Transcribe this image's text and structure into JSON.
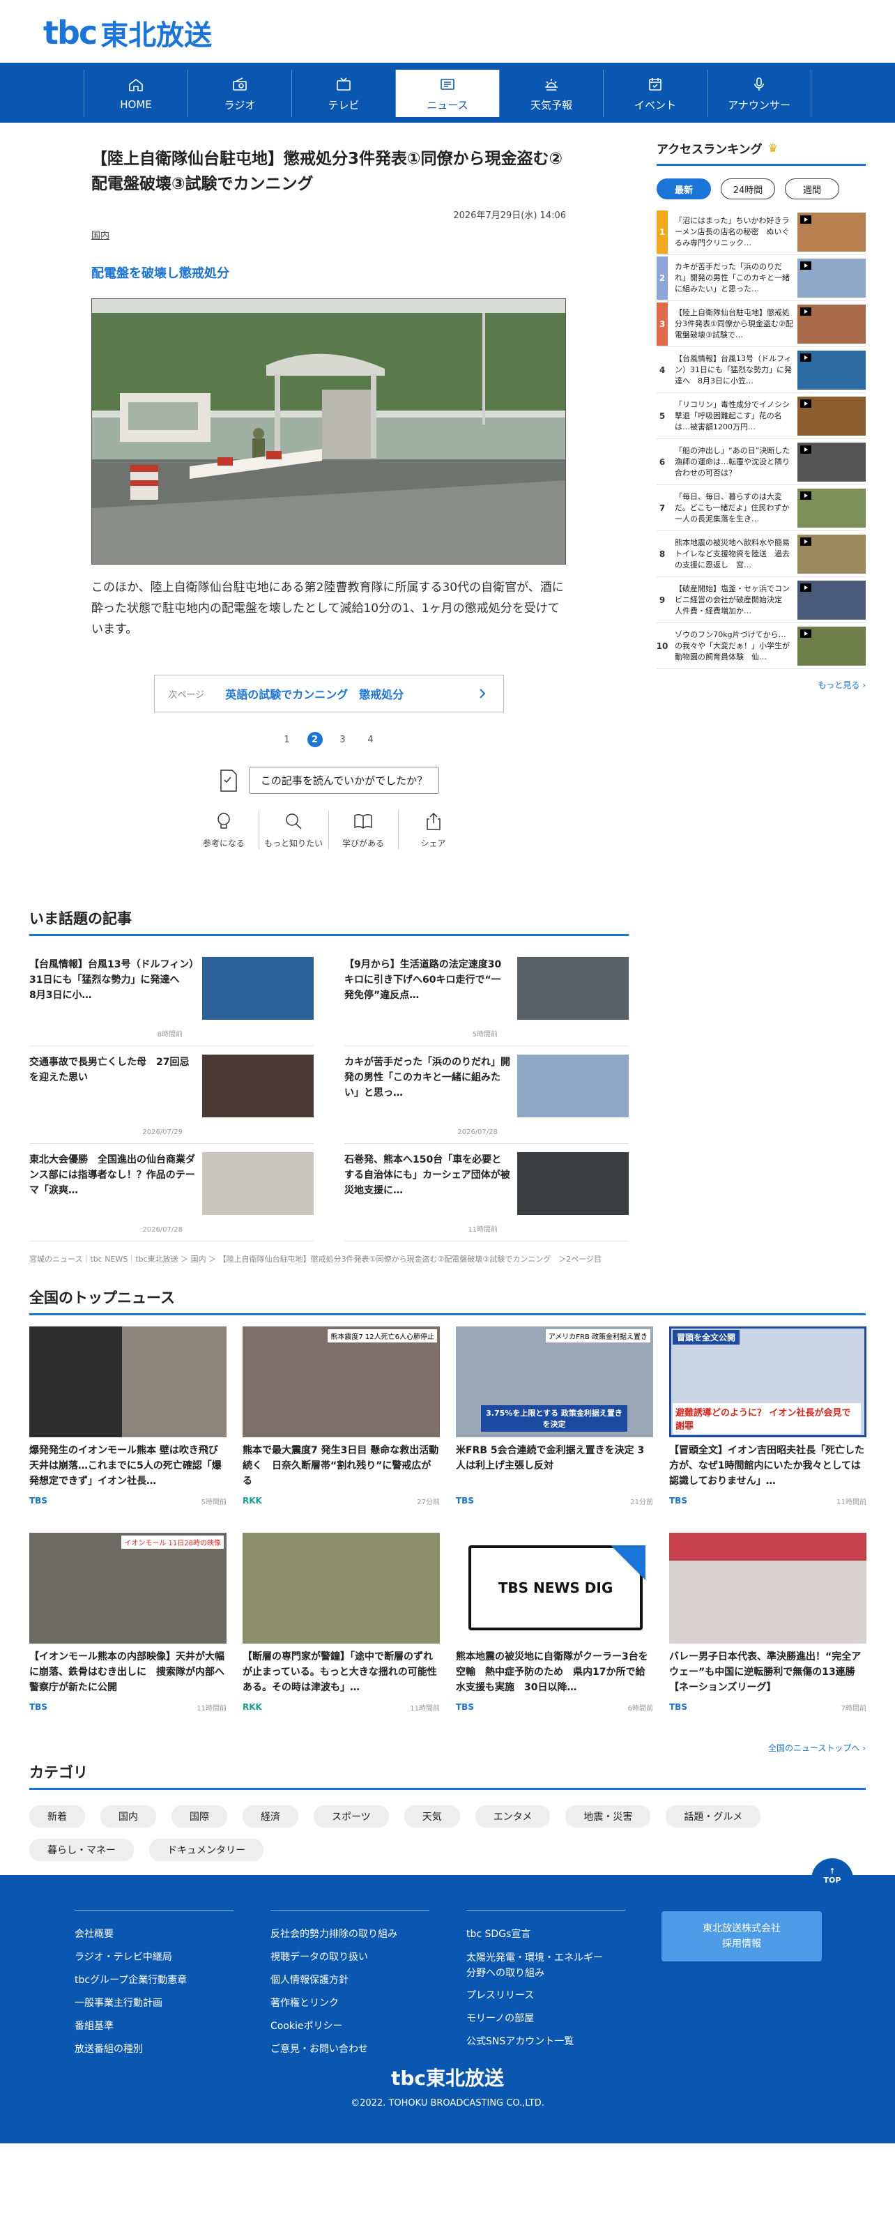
{
  "header": {
    "logo_mark": "tbc",
    "logo_name": "東北放送"
  },
  "nav": [
    {
      "label": "HOME",
      "icon": "home-icon"
    },
    {
      "label": "ラジオ",
      "icon": "radio-icon"
    },
    {
      "label": "テレビ",
      "icon": "tv-icon"
    },
    {
      "label": "ニュース",
      "icon": "news-icon",
      "active": true
    },
    {
      "label": "天気予報",
      "icon": "weather-icon"
    },
    {
      "label": "イベント",
      "icon": "event-icon"
    },
    {
      "label": "アナウンサー",
      "icon": "mic-icon"
    }
  ],
  "article": {
    "title": "【陸上自衛隊仙台駐屯地】懲戒処分3件発表①同僚から現金盗む②配電盤破壊③試験でカンニング",
    "date": "2026年7月29日(水) 14:06",
    "category": "国内",
    "subheading": "配電盤を破壊し懲戒処分",
    "body": "このほか、陸上自衛隊仙台駐屯地にある第2陸曹教育隊に所属する30代の自衛官が、酒に酔った状態で駐屯地内の配電盤を壊したとして減給10分の1、1ヶ月の懲戒処分を受けています。",
    "next_label": "次ページ",
    "next_title": "英語の試験でカンニング　懲戒処分",
    "pages": [
      "1",
      "2",
      "3",
      "4"
    ],
    "current_page": "2",
    "feedback_question": "この記事を読んでいかがでしたか？",
    "reactions": [
      "参考になる",
      "もっと知りたい",
      "学びがある",
      "シェア"
    ]
  },
  "ranking": {
    "title": "アクセスランキング",
    "tabs": [
      "最新",
      "24時間",
      "週間"
    ],
    "active_tab": "最新",
    "items": [
      {
        "rank": "1",
        "text": "「沼にはまった」ちいかわ好きラーメン店長の店名の秘密　ぬいぐるみ専門クリニック…"
      },
      {
        "rank": "2",
        "text": "カキが苦手だった「浜ののりだれ」開発の男性「このカキと一緒に組みたい」と思った…"
      },
      {
        "rank": "3",
        "text": "【陸上自衛隊仙台駐屯地】懲戒処分3件発表①同僚から現金盗む②配電盤破壊③試験で…"
      },
      {
        "rank": "4",
        "text": "【台風情報】台風13号（ドルフィン）31日にも「猛烈な勢力」に発達へ　8月3日に小笠…"
      },
      {
        "rank": "5",
        "text": "「リコリン」毒性成分でイノシシ撃退「呼吸困難起こす」花の名は…被害額1200万円…"
      },
      {
        "rank": "6",
        "text": "「船の沖出し」“あの日”決断した漁師の運命は…転覆や沈没と隣り合わせの可否は？"
      },
      {
        "rank": "7",
        "text": "「毎日、毎日、暮らすのは大変だ。どこも一緒だよ」住民わずか一人の長泥集落を生き…"
      },
      {
        "rank": "8",
        "text": "熊本地震の被災地へ飲料水や簡易トイレなど支援物資を陸送　過去の支援に恩返し　宮…"
      },
      {
        "rank": "9",
        "text": "【破産開始】塩釜・セヶ浜でコンビニ経営の会社が破産開始決定　人件費・経費増加か…"
      },
      {
        "rank": "10",
        "text": "ゾウのフン70kg片づけてから…の我々や「大変だぁ！」小学生が動物園の飼育員体験　仙…"
      }
    ],
    "more": "もっと見る ›"
  },
  "trending": {
    "title": "いま話題の記事",
    "items": [
      {
        "text": "【台風情報】台風13号（ドルフィン）31日にも「猛烈な勢力」に発達へ　8月3日に小…",
        "date": "8時間前"
      },
      {
        "text": "【9月から】生活道路の法定速度30キロに引き下げへ60キロ走行で“一発免停”違反点…",
        "date": "5時間前"
      },
      {
        "text": "交通事故で長男亡くした母　27回忌を迎えた思い",
        "date": "2026/07/29"
      },
      {
        "text": "カキが苦手だった「浜ののりだれ」開発の男性「このカキと一緒に組みたい」と思っ…",
        "date": "2026/07/28"
      },
      {
        "text": "東北大会優勝　全国進出の仙台商業ダンス部には指導者なし！？作品のテーマ「涙爽…",
        "date": "2026/07/28"
      },
      {
        "text": "石巻発、熊本へ150台「車を必要とする自治体にも」カーシェア団体が被災地支援に…",
        "date": "11時間前"
      }
    ]
  },
  "breadcrumb": "宮城のニュース｜tbc NEWS｜tbc東北放送 ＞ 国内 ＞ 【陸上自衛隊仙台駐屯地】懲戒処分3件発表①同僚から現金盗む②配電盤破壊③試験でカンニング　＞2ページ目",
  "national": {
    "title": "全国のトップニュース",
    "items": [
      {
        "text": "爆発発生のイオンモール熊本 壁は吹き飛び天井は崩落…これまでに5人の死亡確認「爆発想定できず」イオン社長…",
        "source": "TBS",
        "date": "5時間前"
      },
      {
        "text": "熊本で最大震度7 発生3日目 懸命な救出活動続く　日奈久断層帯“割れ残り”に警戒広がる",
        "source": "RKK",
        "date": "27分前"
      },
      {
        "text": "米FRB 5会合連続で金利据え置きを決定 3人は利上げ主張し反対",
        "source": "TBS",
        "date": "21分前"
      },
      {
        "text": "【冒頭全文】イオン吉田昭夫社長「死亡した方が、なぜ1時間館内にいたか我々としては認識しておりません」…",
        "source": "TBS",
        "date": "11時間前"
      },
      {
        "text": "【イオンモール熊本の内部映像】天井が大幅に崩落、鉄骨はむき出しに　捜索隊が内部へ　警察庁が新たに公開",
        "source": "TBS",
        "date": "11時間前"
      },
      {
        "text": "【断層の専門家が警鐘】「途中で断層のずれが止まっている。もっと大きな揺れの可能性ある。その時は津波も」…",
        "source": "RKK",
        "date": "11時間前"
      },
      {
        "text": "熊本地震の被災地に自衛隊がクーラー3台を空輸　熱中症予防のため　県内17か所で給水支援も実施　30日以降…",
        "source": "TBS",
        "date": "6時間前"
      },
      {
        "text": "バレー男子日本代表、準決勝進出！“完全アウェー”も中国に逆転勝利で無傷の13連勝【ネーションズリーグ】",
        "source": "TBS",
        "date": "7時間前"
      }
    ],
    "more": "全国のニューストップへ ›",
    "img_captions": [
      "",
      "熊本震度7 12人死亡6人心肺停止",
      "アメリカFRB 政策金利据え置き",
      "冒頭を全文公開",
      "イオンモール 11日28時の映像",
      "",
      "TBS NEWS DIG",
      ""
    ],
    "img_overlays": [
      "",
      "",
      "3.75%を上限とする 政策金利据え置きを決定",
      "避難誘導どのように？ イオン社長が会見で謝罪",
      "",
      "",
      "",
      ""
    ]
  },
  "categories": {
    "title": "カテゴリ",
    "tags": [
      "新着",
      "国内",
      "国際",
      "経済",
      "スポーツ",
      "天気",
      "エンタメ",
      "地震・災害",
      "話題・グルメ",
      "暮らし・マネー",
      "ドキュメンタリー"
    ]
  },
  "footer": {
    "to_top": "TOP",
    "col1": [
      "会社概要",
      "ラジオ・テレビ中継局",
      "tbcグループ企業行動憲章",
      "一般事業主行動計画",
      "番組基準",
      "放送番組の種別"
    ],
    "col2": [
      "反社会的勢力排除の取り組み",
      "視聴データの取り扱い",
      "個人情報保護方針",
      "著作権とリンク",
      "Cookieポリシー",
      "ご意見・お問い合わせ"
    ],
    "col3": [
      "tbc SDGs宣言",
      "太陽光発電・環境・エネルギー",
      "分野への取り組み",
      "プレスリリース",
      "モリーノの部屋",
      "公式SNSアカウント一覧"
    ],
    "recruit_line1": "東北放送株式会社",
    "recruit_line2": "採用情報",
    "logo": "tbc東北放送",
    "copyright": "©2022. TOHOKU BROADCASTING CO.,LTD."
  },
  "colors": {
    "brand_blue": "#0a57b2",
    "link_blue": "#1b74d8",
    "rank1": "#f2a81d",
    "rank2": "#8ba5d8",
    "rank3": "#e06b4b"
  }
}
